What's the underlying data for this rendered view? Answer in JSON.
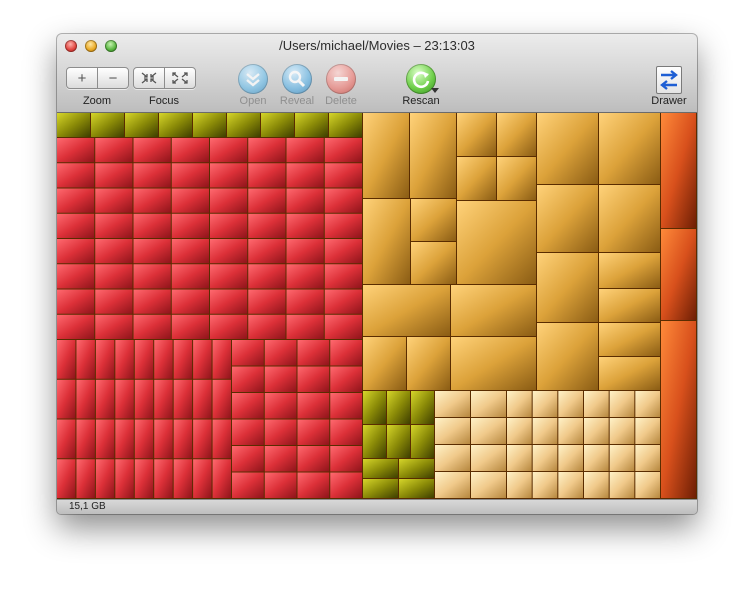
{
  "window": {
    "title": "/Users/michael/Movies – 23:13:03"
  },
  "toolbar": {
    "zoom_label": "Zoom",
    "focus_label": "Focus",
    "open_label": "Open",
    "reveal_label": "Reveal",
    "delete_label": "Delete",
    "rescan_label": "Rescan",
    "drawer_label": "Drawer",
    "zoom_in_glyph": "+",
    "zoom_out_glyph": "−"
  },
  "status": {
    "total_size": "15,1 GB"
  },
  "colors": {
    "red_group": "#d2323a",
    "gold_group": "#d9a33c",
    "olive_group": "#8c8c08",
    "cream_group": "#f0cc8c",
    "orange_group": "#d8501c"
  }
}
